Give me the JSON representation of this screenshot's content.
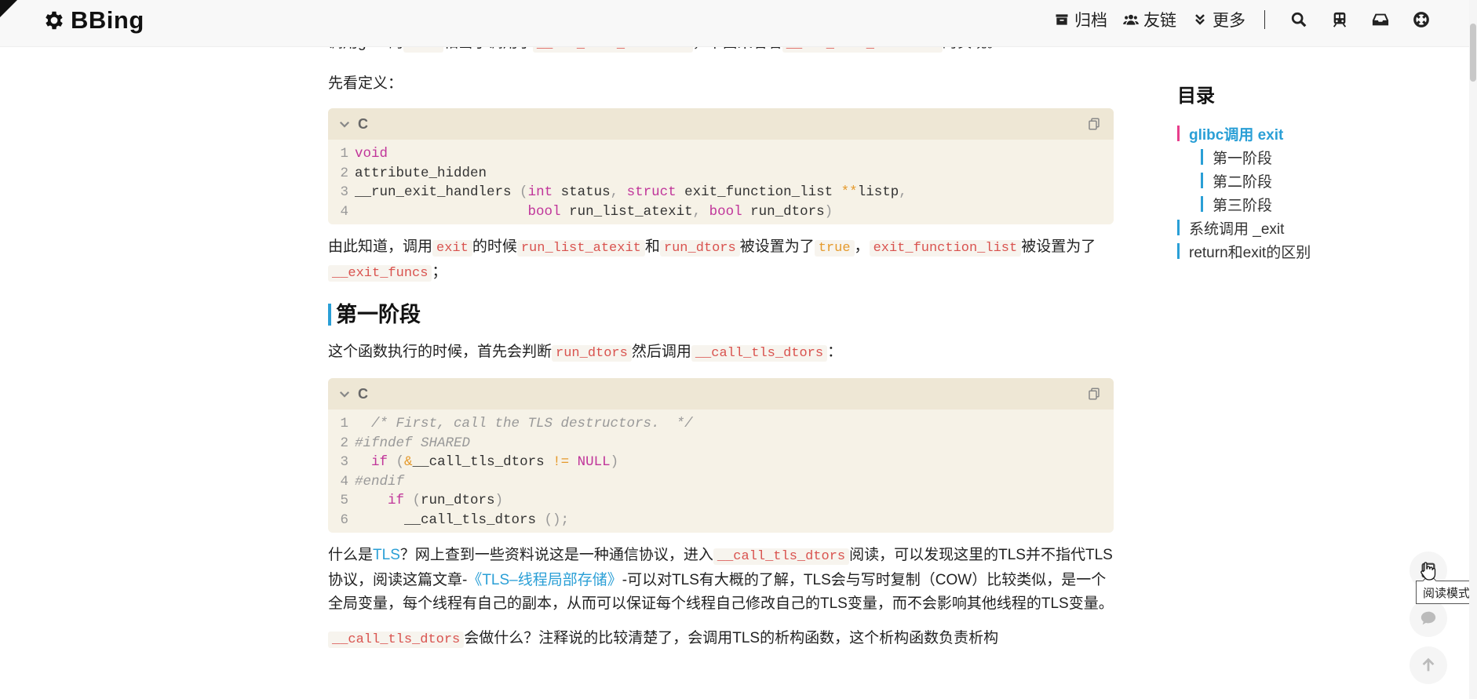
{
  "navbar": {
    "brand": "BBing",
    "items": [
      {
        "label": "归档"
      },
      {
        "label": "友链"
      },
      {
        "label": "更多"
      }
    ]
  },
  "article": {
    "p0": {
      "t1": "调用glibc的",
      "c1": "exit",
      "t2": "相当于调用了",
      "c2": "__run_exit_handlers",
      "t3": "，下面来看看",
      "c3": "__run_exit_handlers",
      "t4": "的实现。"
    },
    "p1": "先看定义：",
    "code1": {
      "lang": "C",
      "lines": [
        {
          "n": "1",
          "a": "void"
        },
        {
          "n": "2",
          "a": "attribute_hidden"
        },
        {
          "n": "3",
          "a": "__run_exit_handlers ",
          "b": "(",
          "c": "int",
          "d": " status",
          "e": ",",
          "f": " struct",
          "g": " exit_function_list ",
          "h": "**",
          "i": "listp",
          "j": ","
        },
        {
          "n": "4",
          "a": "                     ",
          "b": "bool",
          "c": " run_list_atexit",
          "d": ",",
          "e": " bool",
          "f": " run_dtors",
          "g": ")"
        }
      ]
    },
    "p2": {
      "t1": "由此知道，调用",
      "c1": "exit",
      "t2": "的时候",
      "c2": "run_list_atexit",
      "t3": "和",
      "c3": "run_dtors",
      "t4": "被设置为了",
      "c4": "true",
      "t5": "，",
      "c5": "exit_function_list",
      "t6": "被设置为了",
      "c6": "__exit_funcs",
      "t7": "；"
    },
    "h2": "第一阶段",
    "p3": {
      "t1": "这个函数执行的时候，首先会判断",
      "c1": "run_dtors",
      "t2": "然后调用",
      "c2": "__call_tls_dtors",
      "t3": "："
    },
    "code2": {
      "lang": "C",
      "lines": [
        {
          "n": "1",
          "a": "  /* First, call the TLS destructors.  */"
        },
        {
          "n": "2",
          "a": "#ifndef SHARED"
        },
        {
          "n": "3",
          "a": "  ",
          "b": "if",
          "c": " (",
          "d": "&",
          "e": "__call_tls_dtors ",
          "f": "!=",
          "g": " NULL",
          "h": ")"
        },
        {
          "n": "4",
          "a": "#endif"
        },
        {
          "n": "5",
          "a": "    ",
          "b": "if",
          "c": " (",
          "d": "run_dtors",
          "e": ")"
        },
        {
          "n": "6",
          "a": "      __call_tls_dtors ",
          "b": "();"
        }
      ]
    },
    "p4": {
      "t1": "什么是",
      "l1": "TLS",
      "t2": "？网上查到一些资料说这是一种通信协议，进入",
      "c1": "__call_tls_dtors",
      "t3": "阅读，可以发现这里的TLS并不指代TLS协议，阅读这篇文章-",
      "l2": "《TLS–线程局部存储》",
      "t4": "-可以对TLS有大概的了解，TLS会与写时复制（COW）比较类似，是一个全局变量，每个线程有自己的副本，从而可以保证每个线程自己修改自己的TLS变量，而不会影响其他线程的TLS变量。"
    },
    "p5": {
      "c1": "__call_tls_dtors",
      "t1": "会做什么？注释说的比较清楚了，会调用TLS的析构函数，这个析构函数负责析构"
    }
  },
  "toc": {
    "title": "目录",
    "items": [
      {
        "label": "glibc调用 exit"
      },
      {
        "label": "第一阶段"
      },
      {
        "label": "第二阶段"
      },
      {
        "label": "第三阶段"
      },
      {
        "label": "系统调用 _exit"
      },
      {
        "label": "return和exit的区别"
      }
    ]
  },
  "floating": {
    "tooltip": "阅读模式"
  },
  "colors": {
    "accent": "#2a9fd6",
    "active_toc_bar": "#e83e8c",
    "inline_code": "#d9534f",
    "code_bg": "#f6f2e7",
    "code_header_bg": "#eee7d5"
  }
}
